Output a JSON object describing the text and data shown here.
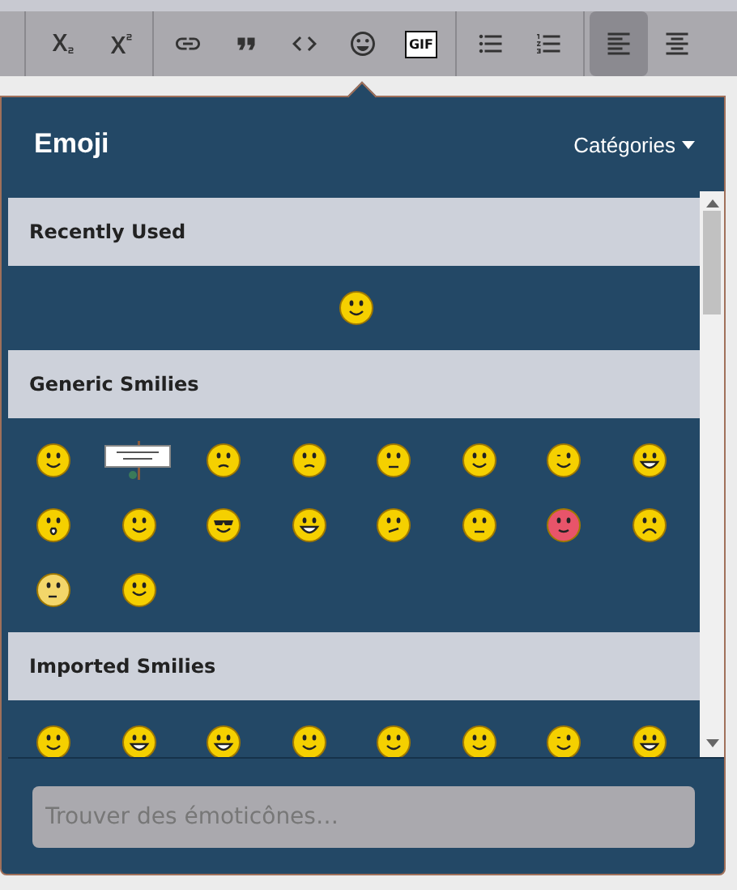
{
  "toolbar": [
    {
      "kind": "subscript",
      "selected": false
    },
    {
      "kind": "superscript",
      "selected": false
    },
    {
      "kind": "sep"
    },
    {
      "kind": "link",
      "selected": false
    },
    {
      "kind": "quote",
      "selected": false
    },
    {
      "kind": "code",
      "selected": false
    },
    {
      "kind": "emoji",
      "selected": false
    },
    {
      "kind": "gif",
      "label": "GIF",
      "selected": false
    },
    {
      "kind": "sep"
    },
    {
      "kind": "bullets",
      "selected": false
    },
    {
      "kind": "numbers",
      "selected": false
    },
    {
      "kind": "sep"
    },
    {
      "kind": "align-left",
      "selected": true
    },
    {
      "kind": "align-center",
      "selected": false
    }
  ],
  "panel": {
    "title": "Emoji",
    "categories": "Catégories",
    "sections": [
      {
        "title": "Recently Used",
        "emojis": [
          {
            "kind": "smile"
          }
        ]
      },
      {
        "title": "Generic Smilies",
        "emojis": [
          {
            "kind": "smile"
          },
          {
            "kind": "sign"
          },
          {
            "kind": "confused"
          },
          {
            "kind": "angry"
          },
          {
            "kind": "worried"
          },
          {
            "kind": "tongue"
          },
          {
            "kind": "wink"
          },
          {
            "kind": "laugh"
          },
          {
            "kind": "surprised"
          },
          {
            "kind": "happy"
          },
          {
            "kind": "cool"
          },
          {
            "kind": "grin"
          },
          {
            "kind": "thinking"
          },
          {
            "kind": "eyeroll"
          },
          {
            "kind": "love"
          },
          {
            "kind": "cry"
          },
          {
            "kind": "ponder"
          },
          {
            "kind": "blush"
          }
        ]
      },
      {
        "title": "Imported Smilies",
        "emojis": [
          {
            "kind": "smile"
          },
          {
            "kind": "grin"
          },
          {
            "kind": "grin"
          },
          {
            "kind": "smile"
          },
          {
            "kind": "smile"
          },
          {
            "kind": "happy"
          },
          {
            "kind": "wink"
          },
          {
            "kind": "grin"
          }
        ]
      }
    ],
    "search": {
      "placeholder": "Trouver des émoticônes…"
    }
  }
}
